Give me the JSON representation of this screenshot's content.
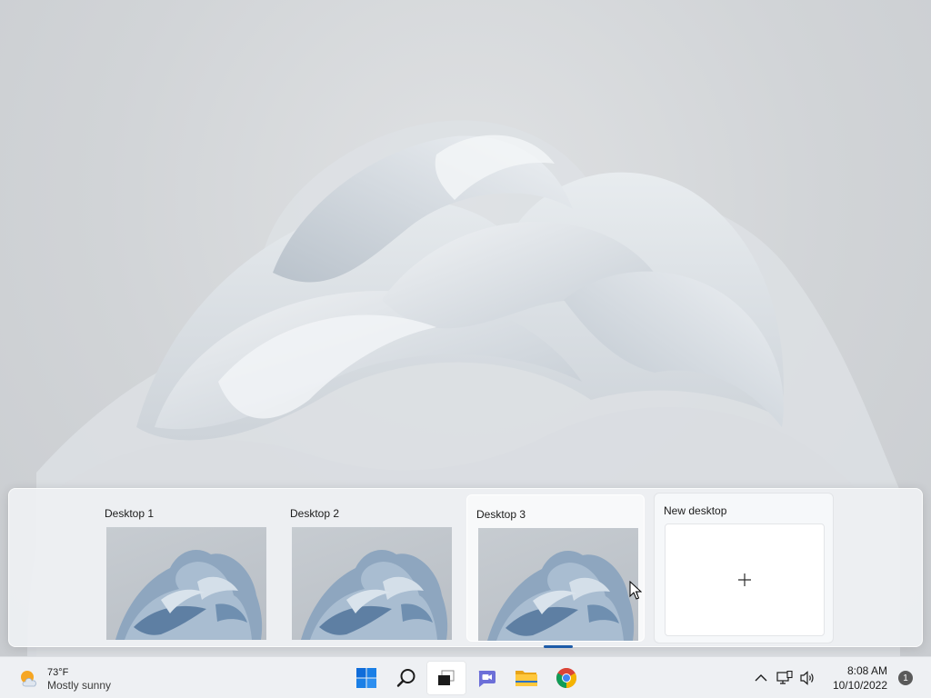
{
  "desktops": [
    {
      "label": "Desktop 1"
    },
    {
      "label": "Desktop 2"
    },
    {
      "label": "Desktop 3"
    }
  ],
  "new_desktop": {
    "label": "New desktop",
    "icon": "plus-icon"
  },
  "taskbar": {
    "weather": {
      "temp": "73°F",
      "condition": "Mostly sunny",
      "icon": "partly-sunny-icon"
    },
    "apps": [
      {
        "name": "start-button",
        "icon": "windows-logo-icon"
      },
      {
        "name": "search-button",
        "icon": "search-icon"
      },
      {
        "name": "task-view-button",
        "icon": "task-view-icon",
        "active": true
      },
      {
        "name": "chat-button",
        "icon": "teams-chat-icon"
      },
      {
        "name": "file-explorer-button",
        "icon": "folder-icon"
      },
      {
        "name": "chrome-button",
        "icon": "chrome-icon"
      }
    ],
    "tray": {
      "icons": [
        "chevron-up-icon",
        "network-icon",
        "volume-icon"
      ],
      "time": "8:08 AM",
      "date": "10/10/2022",
      "notification_count": "1"
    }
  },
  "colors": {
    "accent": "#1d5ba8",
    "taskbar_bg": "#eef0f3"
  }
}
